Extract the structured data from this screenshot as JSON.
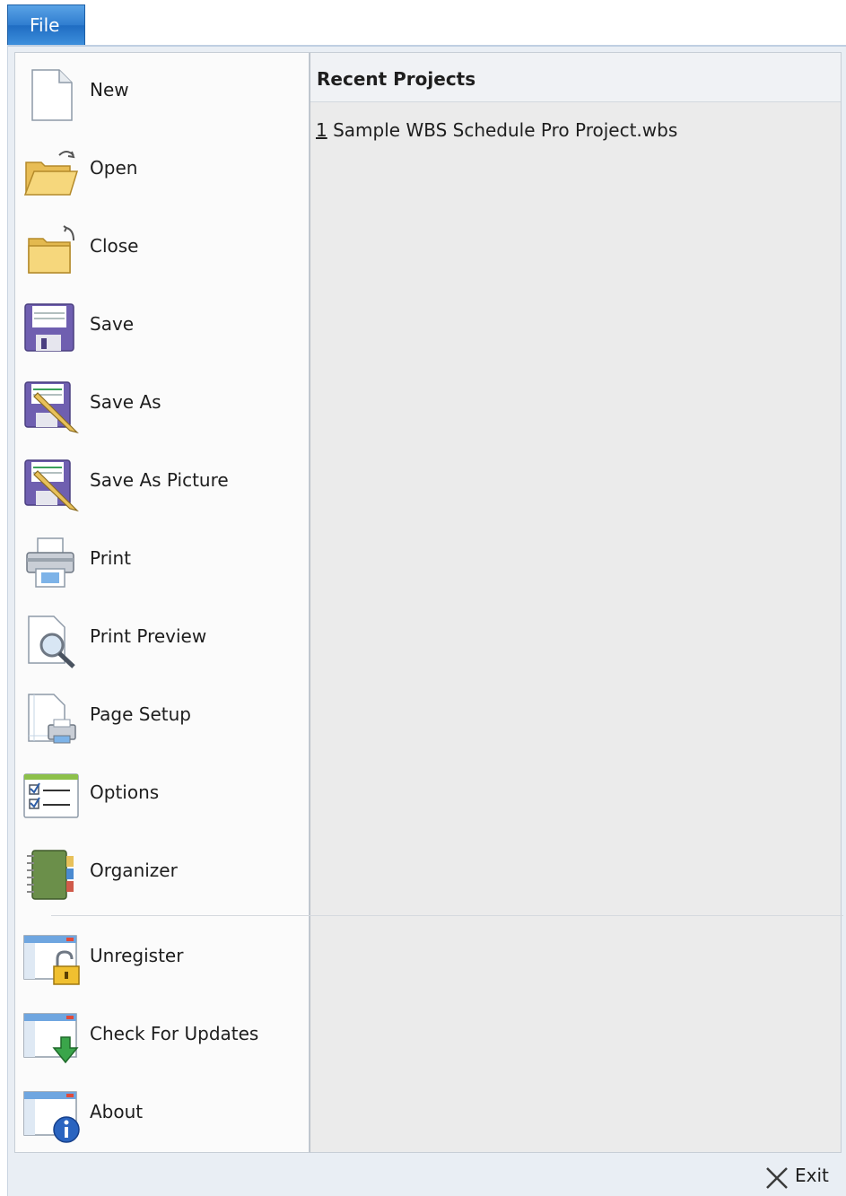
{
  "file_tab": {
    "label": "File"
  },
  "menu": {
    "items": [
      {
        "label": "New",
        "icon": "new-document-icon"
      },
      {
        "label": "Open",
        "icon": "open-folder-icon"
      },
      {
        "label": "Close",
        "icon": "close-folder-icon"
      },
      {
        "label": "Save",
        "icon": "floppy-disk-icon"
      },
      {
        "label": "Save As",
        "icon": "save-as-icon"
      },
      {
        "label": "Save As Picture",
        "icon": "save-as-picture-icon"
      },
      {
        "label": "Print",
        "icon": "printer-icon"
      },
      {
        "label": "Print Preview",
        "icon": "print-preview-icon"
      },
      {
        "label": "Page Setup",
        "icon": "page-setup-icon"
      },
      {
        "label": "Options",
        "icon": "options-checklist-icon"
      },
      {
        "label": "Organizer",
        "icon": "organizer-notebook-icon"
      },
      {
        "label": "Unregister",
        "icon": "unregister-lock-icon"
      },
      {
        "label": "Check For Updates",
        "icon": "check-updates-icon"
      },
      {
        "label": "About",
        "icon": "about-info-icon"
      }
    ]
  },
  "recent": {
    "header": "Recent Projects",
    "items": [
      {
        "number": "1",
        "name": "Sample WBS Schedule Pro Project.wbs"
      }
    ]
  },
  "exit": {
    "label": "Exit",
    "icon": "close-x-icon"
  },
  "colors": {
    "file_tab": "#2f7dd0",
    "frame_bg": "#e9eef4",
    "left_pane_bg": "#fbfbfb",
    "right_pane_bg": "#ebebeb"
  }
}
